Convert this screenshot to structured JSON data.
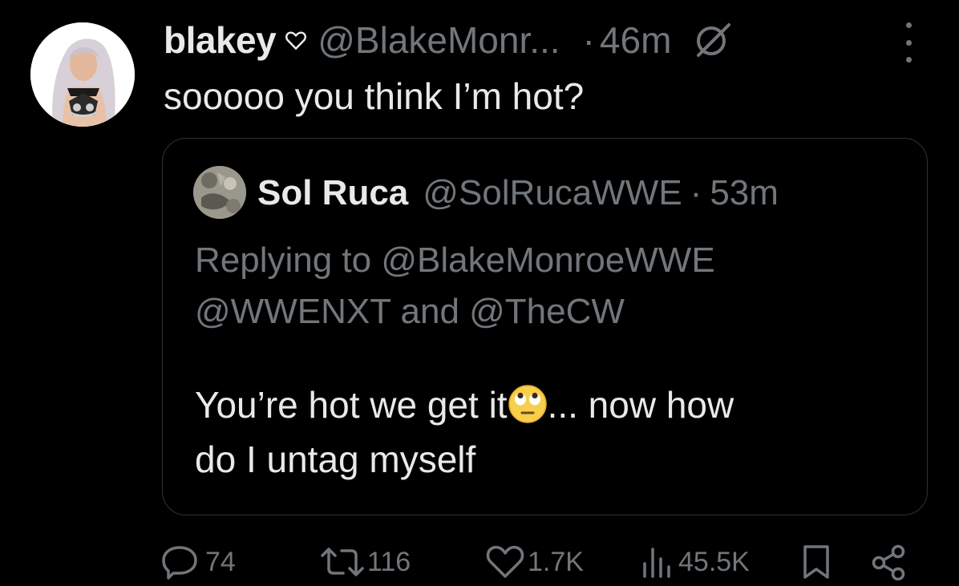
{
  "tweet": {
    "display_name": "blakey",
    "handle": "@BlakeMonr...",
    "separator": "·",
    "time": "46m",
    "text": "sooooo you think I’m hot?",
    "avatar_icon": "profile-photo",
    "badge_icon": "heart-outline-icon",
    "grok_icon": "grok-icon"
  },
  "quote": {
    "display_name": "Sol Ruca",
    "handle": "@SolRucaWWE",
    "separator": "·",
    "time": "53m",
    "replying_line1": "Replying to @BlakeMonroeWWE",
    "replying_line2": "@WWENXT and @TheCW",
    "text_line1_before": "You’re hot we get it",
    "text_line1_after": "... now how",
    "text_line2": "do I untag myself",
    "emoji": "face-with-rolling-eyes"
  },
  "actions": {
    "replies": "74",
    "reposts": "116",
    "likes": "1.7K",
    "views": "45.5K"
  },
  "colors": {
    "background": "#000000",
    "primary_text": "#e7e9ea",
    "secondary_text": "#71767b",
    "border": "#2f3336"
  }
}
